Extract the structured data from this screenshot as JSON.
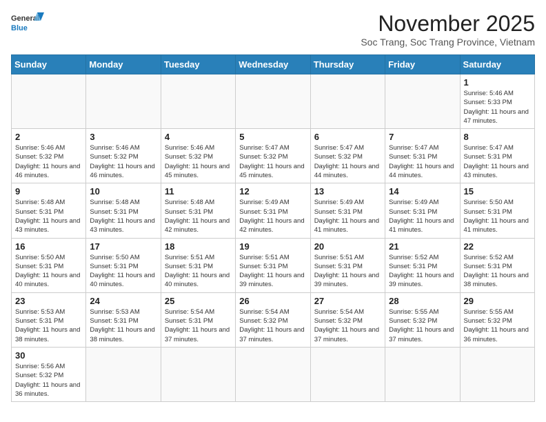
{
  "logo": {
    "text_general": "General",
    "text_blue": "Blue"
  },
  "header": {
    "month_title": "November 2025",
    "location": "Soc Trang, Soc Trang Province, Vietnam"
  },
  "weekdays": [
    "Sunday",
    "Monday",
    "Tuesday",
    "Wednesday",
    "Thursday",
    "Friday",
    "Saturday"
  ],
  "weeks": [
    [
      {
        "day": "",
        "info": ""
      },
      {
        "day": "",
        "info": ""
      },
      {
        "day": "",
        "info": ""
      },
      {
        "day": "",
        "info": ""
      },
      {
        "day": "",
        "info": ""
      },
      {
        "day": "",
        "info": ""
      },
      {
        "day": "1",
        "info": "Sunrise: 5:46 AM\nSunset: 5:33 PM\nDaylight: 11 hours and 47 minutes."
      }
    ],
    [
      {
        "day": "2",
        "info": "Sunrise: 5:46 AM\nSunset: 5:32 PM\nDaylight: 11 hours and 46 minutes."
      },
      {
        "day": "3",
        "info": "Sunrise: 5:46 AM\nSunset: 5:32 PM\nDaylight: 11 hours and 46 minutes."
      },
      {
        "day": "4",
        "info": "Sunrise: 5:46 AM\nSunset: 5:32 PM\nDaylight: 11 hours and 45 minutes."
      },
      {
        "day": "5",
        "info": "Sunrise: 5:47 AM\nSunset: 5:32 PM\nDaylight: 11 hours and 45 minutes."
      },
      {
        "day": "6",
        "info": "Sunrise: 5:47 AM\nSunset: 5:32 PM\nDaylight: 11 hours and 44 minutes."
      },
      {
        "day": "7",
        "info": "Sunrise: 5:47 AM\nSunset: 5:31 PM\nDaylight: 11 hours and 44 minutes."
      },
      {
        "day": "8",
        "info": "Sunrise: 5:47 AM\nSunset: 5:31 PM\nDaylight: 11 hours and 43 minutes."
      }
    ],
    [
      {
        "day": "9",
        "info": "Sunrise: 5:48 AM\nSunset: 5:31 PM\nDaylight: 11 hours and 43 minutes."
      },
      {
        "day": "10",
        "info": "Sunrise: 5:48 AM\nSunset: 5:31 PM\nDaylight: 11 hours and 43 minutes."
      },
      {
        "day": "11",
        "info": "Sunrise: 5:48 AM\nSunset: 5:31 PM\nDaylight: 11 hours and 42 minutes."
      },
      {
        "day": "12",
        "info": "Sunrise: 5:49 AM\nSunset: 5:31 PM\nDaylight: 11 hours and 42 minutes."
      },
      {
        "day": "13",
        "info": "Sunrise: 5:49 AM\nSunset: 5:31 PM\nDaylight: 11 hours and 41 minutes."
      },
      {
        "day": "14",
        "info": "Sunrise: 5:49 AM\nSunset: 5:31 PM\nDaylight: 11 hours and 41 minutes."
      },
      {
        "day": "15",
        "info": "Sunrise: 5:50 AM\nSunset: 5:31 PM\nDaylight: 11 hours and 41 minutes."
      }
    ],
    [
      {
        "day": "16",
        "info": "Sunrise: 5:50 AM\nSunset: 5:31 PM\nDaylight: 11 hours and 40 minutes."
      },
      {
        "day": "17",
        "info": "Sunrise: 5:50 AM\nSunset: 5:31 PM\nDaylight: 11 hours and 40 minutes."
      },
      {
        "day": "18",
        "info": "Sunrise: 5:51 AM\nSunset: 5:31 PM\nDaylight: 11 hours and 40 minutes."
      },
      {
        "day": "19",
        "info": "Sunrise: 5:51 AM\nSunset: 5:31 PM\nDaylight: 11 hours and 39 minutes."
      },
      {
        "day": "20",
        "info": "Sunrise: 5:51 AM\nSunset: 5:31 PM\nDaylight: 11 hours and 39 minutes."
      },
      {
        "day": "21",
        "info": "Sunrise: 5:52 AM\nSunset: 5:31 PM\nDaylight: 11 hours and 39 minutes."
      },
      {
        "day": "22",
        "info": "Sunrise: 5:52 AM\nSunset: 5:31 PM\nDaylight: 11 hours and 38 minutes."
      }
    ],
    [
      {
        "day": "23",
        "info": "Sunrise: 5:53 AM\nSunset: 5:31 PM\nDaylight: 11 hours and 38 minutes."
      },
      {
        "day": "24",
        "info": "Sunrise: 5:53 AM\nSunset: 5:31 PM\nDaylight: 11 hours and 38 minutes."
      },
      {
        "day": "25",
        "info": "Sunrise: 5:54 AM\nSunset: 5:31 PM\nDaylight: 11 hours and 37 minutes."
      },
      {
        "day": "26",
        "info": "Sunrise: 5:54 AM\nSunset: 5:32 PM\nDaylight: 11 hours and 37 minutes."
      },
      {
        "day": "27",
        "info": "Sunrise: 5:54 AM\nSunset: 5:32 PM\nDaylight: 11 hours and 37 minutes."
      },
      {
        "day": "28",
        "info": "Sunrise: 5:55 AM\nSunset: 5:32 PM\nDaylight: 11 hours and 37 minutes."
      },
      {
        "day": "29",
        "info": "Sunrise: 5:55 AM\nSunset: 5:32 PM\nDaylight: 11 hours and 36 minutes."
      }
    ],
    [
      {
        "day": "30",
        "info": "Sunrise: 5:56 AM\nSunset: 5:32 PM\nDaylight: 11 hours and 36 minutes."
      },
      {
        "day": "",
        "info": ""
      },
      {
        "day": "",
        "info": ""
      },
      {
        "day": "",
        "info": ""
      },
      {
        "day": "",
        "info": ""
      },
      {
        "day": "",
        "info": ""
      },
      {
        "day": "",
        "info": ""
      }
    ]
  ]
}
